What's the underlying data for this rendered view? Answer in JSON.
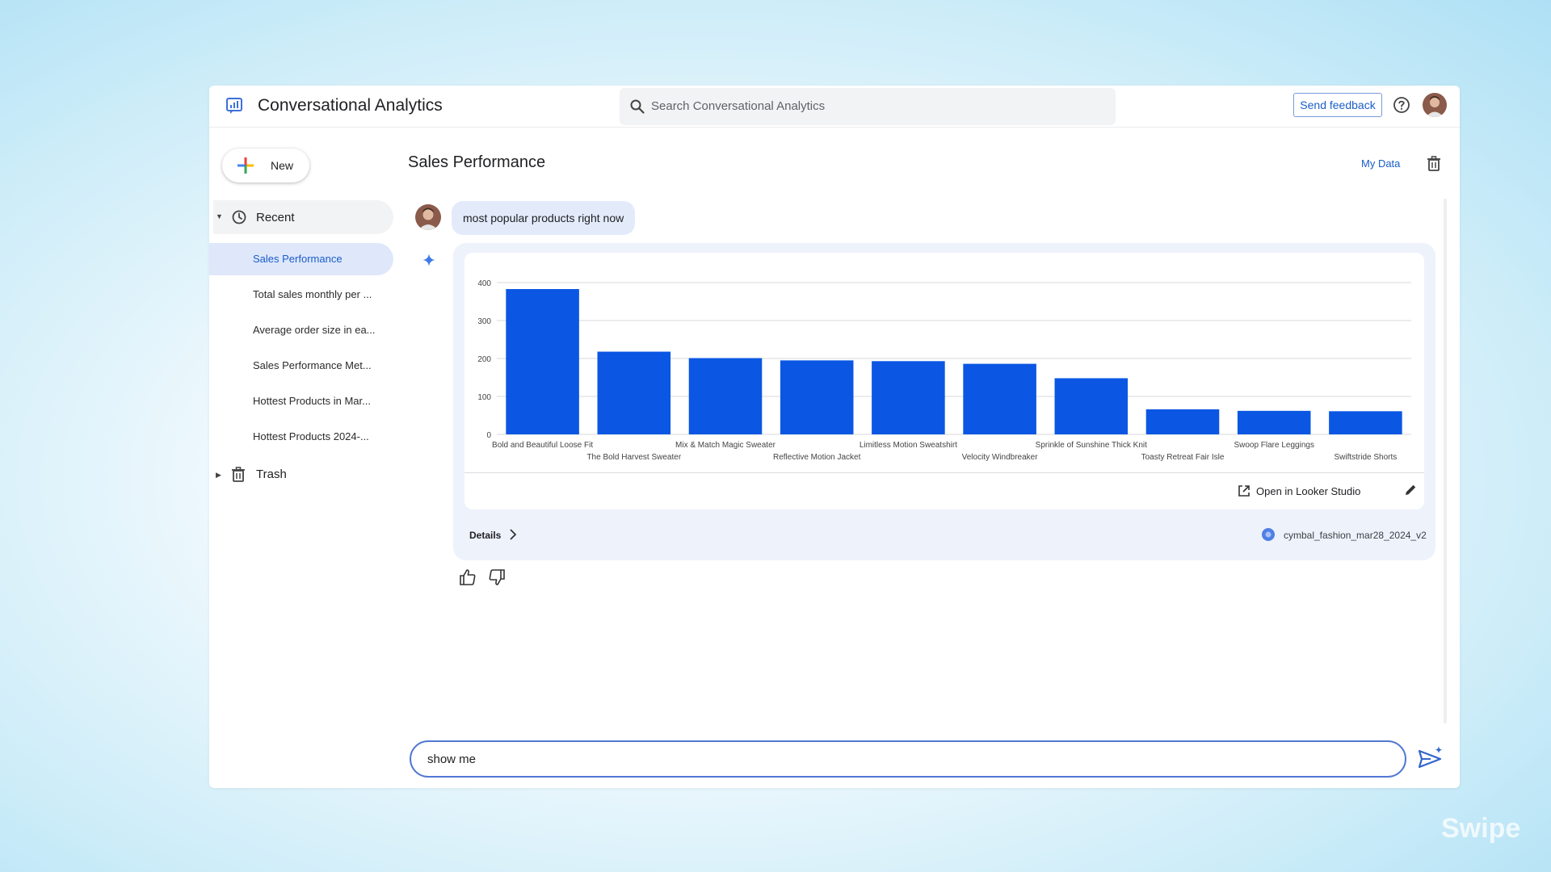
{
  "header": {
    "app_title": "Conversational Analytics",
    "search_placeholder": "Search Conversational Analytics",
    "feedback_label": "Send feedback"
  },
  "sidebar": {
    "new_label": "New",
    "recent_label": "Recent",
    "items": [
      {
        "label": "Sales Performance",
        "active": true
      },
      {
        "label": "Total sales monthly per ...",
        "active": false
      },
      {
        "label": "Average order size in ea...",
        "active": false
      },
      {
        "label": "Sales Performance Met...",
        "active": false
      },
      {
        "label": "Hottest Products in Mar...",
        "active": false
      },
      {
        "label": "Hottest Products 2024-...",
        "active": false
      }
    ],
    "trash_label": "Trash"
  },
  "main": {
    "title": "Sales Performance",
    "my_data_label": "My Data",
    "user_message": "most popular products right now",
    "open_looker_label": "Open in Looker Studio",
    "details_label": "Details",
    "data_source": "cymbal_fashion_mar28_2024_v2",
    "prompt_value": "show me"
  },
  "watermark": "Swipe",
  "colors": {
    "accent": "#1a5dc9",
    "bar": "#0b57e3",
    "bubble": "#e3ebfb",
    "card": "#eef2fb"
  },
  "chart_data": {
    "type": "bar",
    "title": "",
    "xlabel": "",
    "ylabel": "",
    "ylim": [
      0,
      400
    ],
    "yticks": [
      0,
      100,
      200,
      300,
      400
    ],
    "grid": true,
    "categories": [
      "Bold and Beautiful Loose Fit",
      "The Bold Harvest Sweater",
      "Mix & Match Magic Sweater",
      "Reflective Motion Jacket",
      "Limitless Motion Sweatshirt",
      "Velocity Windbreaker",
      "Sprinkle of Sunshine Thick Knit",
      "Toasty Retreat Fair Isle",
      "Swoop Flare Leggings",
      "Swiftstride Shorts"
    ],
    "values": [
      383,
      218,
      201,
      195,
      193,
      186,
      148,
      66,
      62,
      61
    ]
  }
}
